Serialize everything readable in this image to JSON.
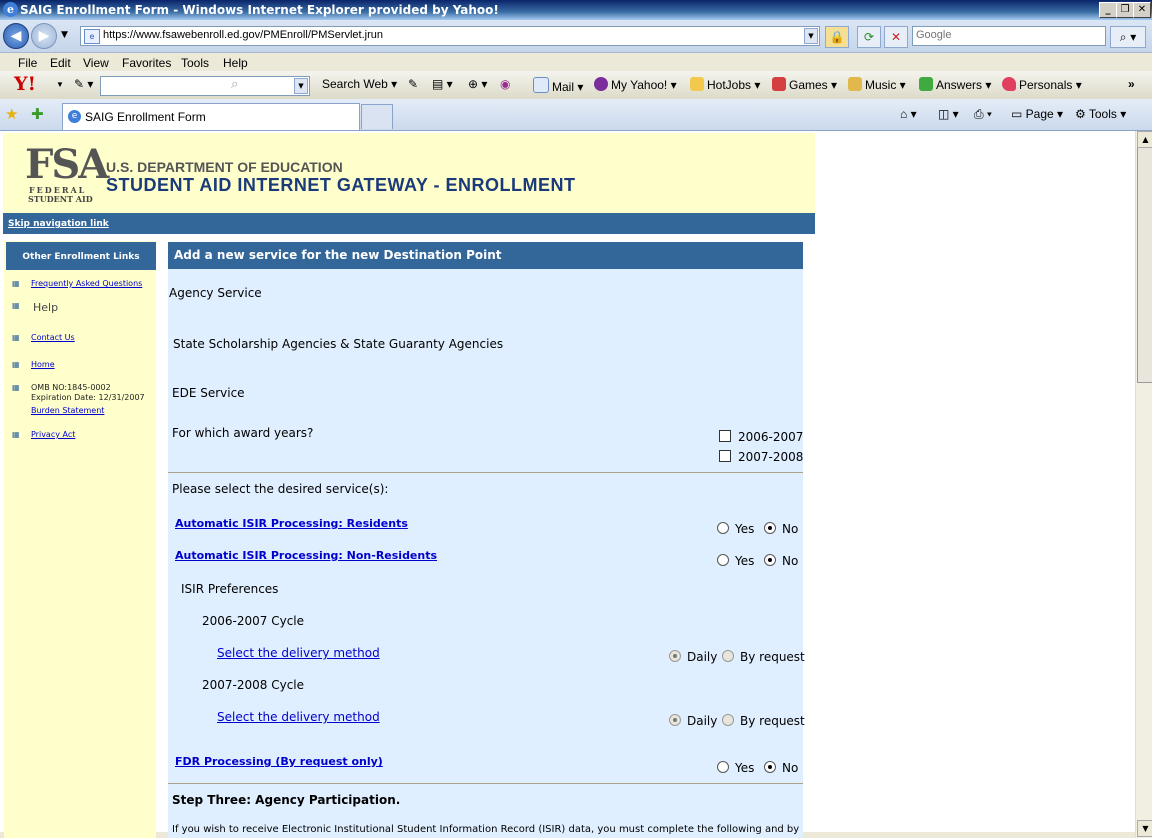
{
  "window": {
    "title": "SAIG Enrollment Form - Windows Internet Explorer provided by Yahoo!"
  },
  "address_bar": {
    "url": "https://www.fsawebenroll.ed.gov/PMEnroll/PMServlet.jrun",
    "search_placeholder": "Google"
  },
  "menu": [
    "File",
    "Edit",
    "View",
    "Favorites",
    "Tools",
    "Help"
  ],
  "yahoo_toolbar": {
    "search_web": "Search Web",
    "items": [
      "Mail",
      "My Yahoo!",
      "HotJobs",
      "Games",
      "Music",
      "Answers",
      "Personals"
    ]
  },
  "tab": {
    "title": "SAIG Enrollment Form"
  },
  "tab_right": {
    "page": "Page",
    "tools": "Tools"
  },
  "header": {
    "logo_main": "FSA",
    "logo_line1": "FEDERAL",
    "logo_line2": "STUDENT AID",
    "dept": "U.S. DEPARTMENT OF EDUCATION",
    "title": "STUDENT AID INTERNET GATEWAY - ENROLLMENT"
  },
  "skip_link": "Skip navigation link",
  "sidebar": {
    "heading": "Other Enrollment Links",
    "faq": "Frequently Asked Questions",
    "help": "Help",
    "contact": "Contact Us",
    "home": "Home",
    "omb": "OMB NO:1845-0002",
    "expiration": "Expiration Date:  12/31/2007",
    "burden": "Burden Statement",
    "privacy": "Privacy Act"
  },
  "main": {
    "heading": "Add a new service for the new Destination Point",
    "agency_service": "Agency Service",
    "agency_type": "State Scholarship Agencies & State Guaranty Agencies",
    "ede_service": "EDE Service",
    "award_question": "For which award years?",
    "award_years": [
      "2006-2007",
      "2007-2008"
    ],
    "select_services": "Please select the desired service(s):",
    "isir_residents": "Automatic ISIR Processing:  Residents",
    "isir_nonresidents": "Automatic ISIR Processing:  Non-Residents",
    "yes": "Yes",
    "no": "No",
    "isir_prefs": "ISIR Preferences",
    "cycle1": "2006-2007 Cycle",
    "cycle2": "2007-2008 Cycle",
    "delivery_link": " Select the delivery method",
    "daily": "Daily",
    "by_request": "By request",
    "fdr": "FDR Processing (By request only)",
    "step_three": "Step Three: Agency Participation.",
    "cut_text": "If you wish to receive Electronic Institutional Student Information Record (ISIR) data, you must complete the following and by doing"
  }
}
